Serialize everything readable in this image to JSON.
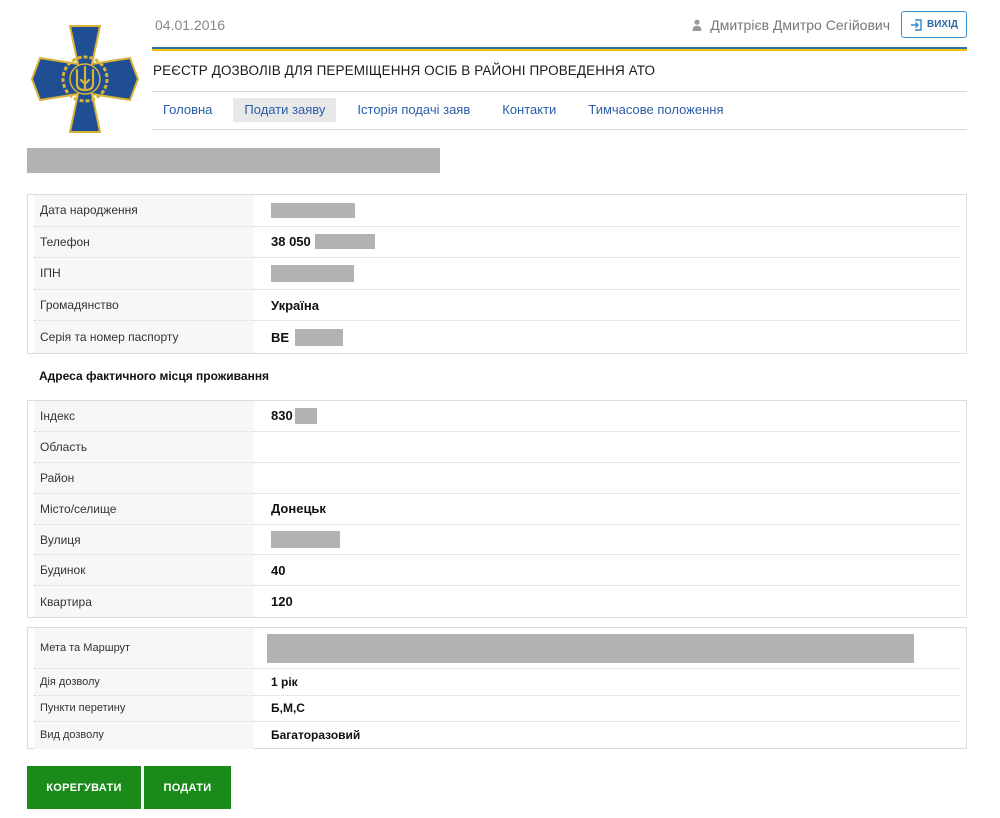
{
  "header": {
    "date": "04.01.2016",
    "user_name": "Дмитрієв Дмитро Сегійович",
    "logout_label": "ВИХІД",
    "site_title": "РЕЄСТР ДОЗВОЛІВ ДЛЯ ПЕРЕМІЩЕННЯ ОСІБ В РАЙОНІ ПРОВЕДЕННЯ АТО"
  },
  "nav": {
    "items": [
      {
        "label": "Головна",
        "active": false
      },
      {
        "label": "Подати заяву",
        "active": true
      },
      {
        "label": "Історія подачі заяв",
        "active": false
      },
      {
        "label": "Контакти",
        "active": false
      },
      {
        "label": "Тимчасове положення",
        "active": false
      }
    ]
  },
  "personal": {
    "birth_date_label": "Дата народження",
    "phone_label": "Телефон",
    "phone_value": "38 050",
    "inn_label": "ІПН",
    "citizenship_label": "Громадянство",
    "citizenship_value": "Україна",
    "passport_label": "Серія та номер паспорту",
    "passport_value": "ВЕ"
  },
  "address": {
    "heading": "Адреса фактичного місця проживання",
    "index_label": "Індекс",
    "index_value": "830",
    "region_label": "Область",
    "district_label": "Район",
    "city_label": "Місто/селище",
    "city_value": "Донецьк",
    "street_label": "Вулиця",
    "house_label": "Будинок",
    "house_value": "40",
    "apartment_label": "Квартира",
    "apartment_value": "120"
  },
  "permit": {
    "route_label": "Мета та Маршрут",
    "duration_label": "Дія дозволу",
    "duration_value": "1 рік",
    "crossings_label": "Пункти перетину",
    "crossings_value": "Б,М,С",
    "type_label": "Вид дозволу",
    "type_value": "Багаторазовий"
  },
  "buttons": {
    "edit_label": "КОРЕГУВАТИ",
    "submit_label": "ПОДАТИ"
  },
  "colors": {
    "accent_blue": "#2f6fb5",
    "accent_yellow": "#f5c400",
    "button_green": "#1a8a1a",
    "emblem_blue": "#1f4e93",
    "emblem_gold": "#d9b23a"
  }
}
